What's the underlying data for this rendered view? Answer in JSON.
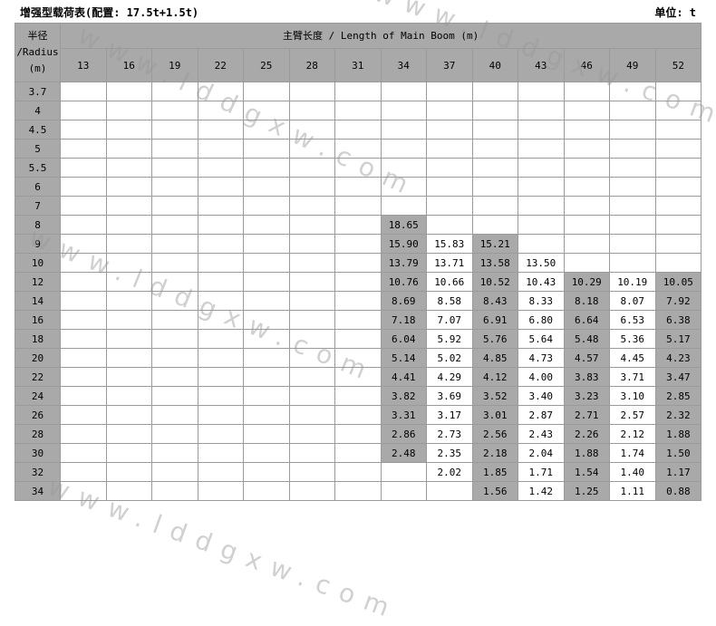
{
  "title": "增强型载荷表(配置: 17.5t+1.5t)",
  "unit": "单位: t",
  "radius_header": [
    "半径",
    "/Radius",
    "(m)"
  ],
  "boom_header": "主臂长度 / Length of Main Boom (m)",
  "boom_lengths": [
    "13",
    "16",
    "19",
    "22",
    "25",
    "28",
    "31",
    "34",
    "37",
    "40",
    "43",
    "46",
    "49",
    "52"
  ],
  "rows": [
    {
      "radius": "3.7",
      "cells": [
        "",
        "",
        "",
        "",
        "",
        "",
        "",
        "",
        "",
        "",
        "",
        "",
        "",
        ""
      ]
    },
    {
      "radius": "4",
      "cells": [
        "",
        "",
        "",
        "",
        "",
        "",
        "",
        "",
        "",
        "",
        "",
        "",
        "",
        ""
      ]
    },
    {
      "radius": "4.5",
      "cells": [
        "",
        "",
        "",
        "",
        "",
        "",
        "",
        "",
        "",
        "",
        "",
        "",
        "",
        ""
      ]
    },
    {
      "radius": "5",
      "cells": [
        "",
        "",
        "",
        "",
        "",
        "",
        "",
        "",
        "",
        "",
        "",
        "",
        "",
        ""
      ]
    },
    {
      "radius": "5.5",
      "cells": [
        "",
        "",
        "",
        "",
        "",
        "",
        "",
        "",
        "",
        "",
        "",
        "",
        "",
        ""
      ]
    },
    {
      "radius": "6",
      "cells": [
        "",
        "",
        "",
        "",
        "",
        "",
        "",
        "",
        "",
        "",
        "",
        "",
        "",
        ""
      ]
    },
    {
      "radius": "7",
      "cells": [
        "",
        "",
        "",
        "",
        "",
        "",
        "",
        "",
        "",
        "",
        "",
        "",
        "",
        ""
      ]
    },
    {
      "radius": "8",
      "cells": [
        "",
        "",
        "",
        "",
        "",
        "",
        "",
        "18.65",
        "",
        "",
        "",
        "",
        "",
        ""
      ]
    },
    {
      "radius": "9",
      "cells": [
        "",
        "",
        "",
        "",
        "",
        "",
        "",
        "15.90",
        "15.83",
        "15.21",
        "",
        "",
        "",
        ""
      ]
    },
    {
      "radius": "10",
      "cells": [
        "",
        "",
        "",
        "",
        "",
        "",
        "",
        "13.79",
        "13.71",
        "13.58",
        "13.50",
        "",
        "",
        ""
      ]
    },
    {
      "radius": "12",
      "cells": [
        "",
        "",
        "",
        "",
        "",
        "",
        "",
        "10.76",
        "10.66",
        "10.52",
        "10.43",
        "10.29",
        "10.19",
        "10.05"
      ]
    },
    {
      "radius": "14",
      "cells": [
        "",
        "",
        "",
        "",
        "",
        "",
        "",
        "8.69",
        "8.58",
        "8.43",
        "8.33",
        "8.18",
        "8.07",
        "7.92"
      ]
    },
    {
      "radius": "16",
      "cells": [
        "",
        "",
        "",
        "",
        "",
        "",
        "",
        "7.18",
        "7.07",
        "6.91",
        "6.80",
        "6.64",
        "6.53",
        "6.38"
      ]
    },
    {
      "radius": "18",
      "cells": [
        "",
        "",
        "",
        "",
        "",
        "",
        "",
        "6.04",
        "5.92",
        "5.76",
        "5.64",
        "5.48",
        "5.36",
        "5.17"
      ]
    },
    {
      "radius": "20",
      "cells": [
        "",
        "",
        "",
        "",
        "",
        "",
        "",
        "5.14",
        "5.02",
        "4.85",
        "4.73",
        "4.57",
        "4.45",
        "4.23"
      ]
    },
    {
      "radius": "22",
      "cells": [
        "",
        "",
        "",
        "",
        "",
        "",
        "",
        "4.41",
        "4.29",
        "4.12",
        "4.00",
        "3.83",
        "3.71",
        "3.47"
      ]
    },
    {
      "radius": "24",
      "cells": [
        "",
        "",
        "",
        "",
        "",
        "",
        "",
        "3.82",
        "3.69",
        "3.52",
        "3.40",
        "3.23",
        "3.10",
        "2.85"
      ]
    },
    {
      "radius": "26",
      "cells": [
        "",
        "",
        "",
        "",
        "",
        "",
        "",
        "3.31",
        "3.17",
        "3.01",
        "2.87",
        "2.71",
        "2.57",
        "2.32"
      ]
    },
    {
      "radius": "28",
      "cells": [
        "",
        "",
        "",
        "",
        "",
        "",
        "",
        "2.86",
        "2.73",
        "2.56",
        "2.43",
        "2.26",
        "2.12",
        "1.88"
      ]
    },
    {
      "radius": "30",
      "cells": [
        "",
        "",
        "",
        "",
        "",
        "",
        "",
        "2.48",
        "2.35",
        "2.18",
        "2.04",
        "1.88",
        "1.74",
        "1.50"
      ]
    },
    {
      "radius": "32",
      "cells": [
        "",
        "",
        "",
        "",
        "",
        "",
        "",
        "",
        "2.02",
        "1.85",
        "1.71",
        "1.54",
        "1.40",
        "1.17"
      ]
    },
    {
      "radius": "34",
      "cells": [
        "",
        "",
        "",
        "",
        "",
        "",
        "",
        "",
        "",
        "1.56",
        "1.42",
        "1.25",
        "1.11",
        "0.88"
      ]
    }
  ],
  "watermark": "www.lddgxw.com",
  "colors": {
    "header_gray": "#a9a9a9",
    "grid": "#9a9a9a",
    "white": "#ffffff"
  }
}
